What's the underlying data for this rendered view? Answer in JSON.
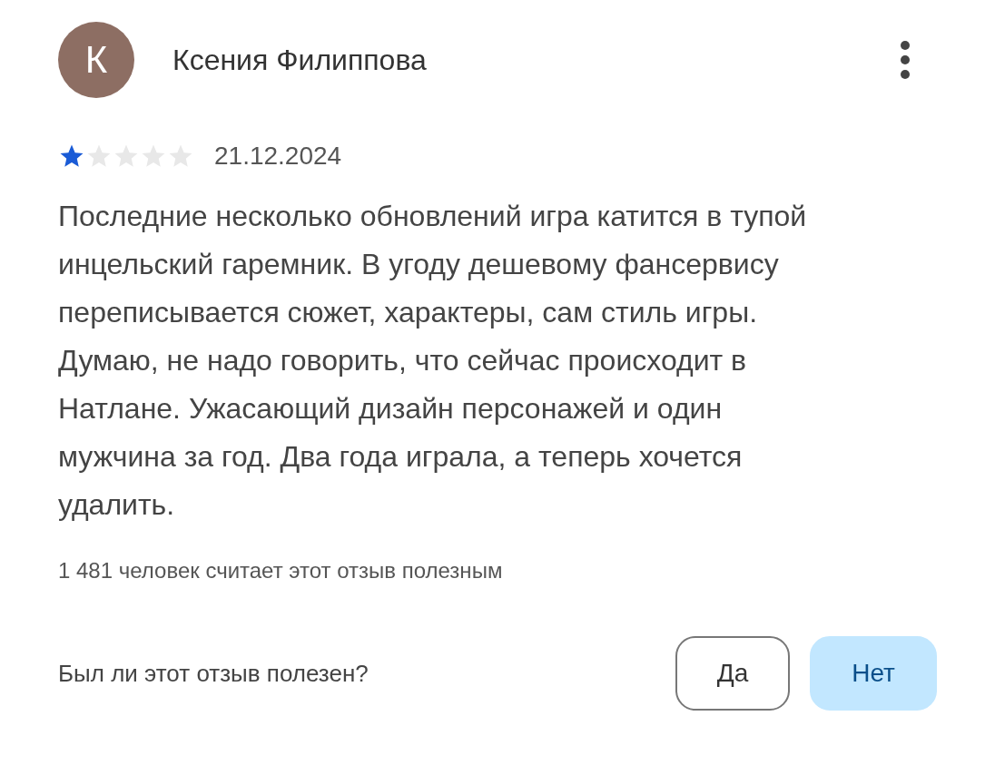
{
  "review": {
    "author_initial": "К",
    "author": "Ксения Филиппова",
    "stars": 1,
    "date": "21.12.2024",
    "text": "Последние несколько обновлений игра катится в тупой инцельский гаремник. В угоду дешевому фансервису переписывается сюжет, характеры, сам стиль игры. Думаю, не надо говорить, что сейчас происходит в Натлане. Ужасающий дизайн персонажей и один мужчина за год. Два года играла, а теперь хочется удалить.",
    "helpful_count": "1 481 человек считает этот отзыв полезным"
  },
  "feedback": {
    "question": "Был ли этот отзыв полезен?",
    "buttons": [
      {
        "label": "Да",
        "selected": false
      },
      {
        "label": "Нет",
        "selected": true
      }
    ]
  }
}
